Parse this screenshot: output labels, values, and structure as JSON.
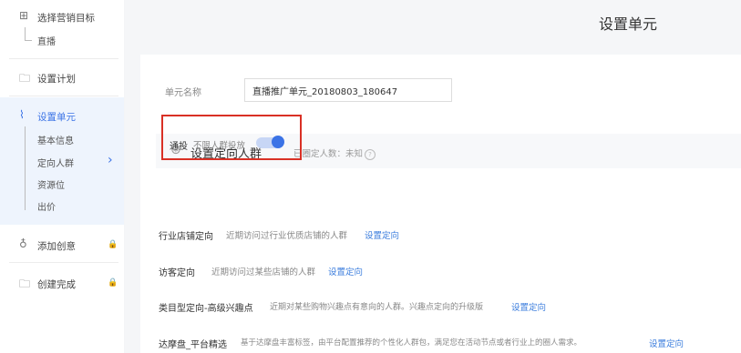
{
  "sidebar": {
    "steps": [
      {
        "label": "选择营销目标",
        "icon": "grid-icon",
        "sub": [
          "直播"
        ],
        "locked": false
      },
      {
        "label": "设置计划",
        "icon": "folder-icon",
        "sub": [],
        "locked": false
      },
      {
        "label": "设置单元",
        "icon": "pulse-icon",
        "sub": [
          "基本信息",
          "定向人群",
          "资源位",
          "出价"
        ],
        "locked": false,
        "active": true
      },
      {
        "label": "添加创意",
        "icon": "bulb-icon",
        "sub": [],
        "locked": true
      },
      {
        "label": "创建完成",
        "icon": "folder-icon",
        "sub": [],
        "locked": true
      }
    ],
    "accent": "#3b73e6"
  },
  "header": {
    "title": "设置单元"
  },
  "unit": {
    "name_label": "单元名称",
    "name_value": "直播推广单元_20180803_180647"
  },
  "targeting": {
    "title": "设置定向人群",
    "count_label": "已圈定人数：",
    "count_value": "未知",
    "general": {
      "title": "通投",
      "desc": "不限人群投放",
      "enabled": true
    },
    "rows": [
      {
        "title": "行业店铺定向",
        "desc": "近期访问过行业优质店铺的人群",
        "link": "设置定向"
      },
      {
        "title": "访客定向",
        "desc": "近期访问过某些店铺的人群",
        "link": "设置定向"
      },
      {
        "title": "类目型定向-高级兴趣点",
        "desc": "近期对某些购物兴趣点有意向的人群。兴趣点定向的升级版",
        "link": "设置定向"
      },
      {
        "title": "达摩盘_平台精选",
        "desc": "基于达摩盘丰富标签，由平台配置推荐的个性化人群包，满足您在活动节点或者行业上的圈人需求。",
        "link": "设置定向"
      }
    ]
  },
  "colors": {
    "highlight_border": "#d93025",
    "link": "#3b7ddd"
  }
}
